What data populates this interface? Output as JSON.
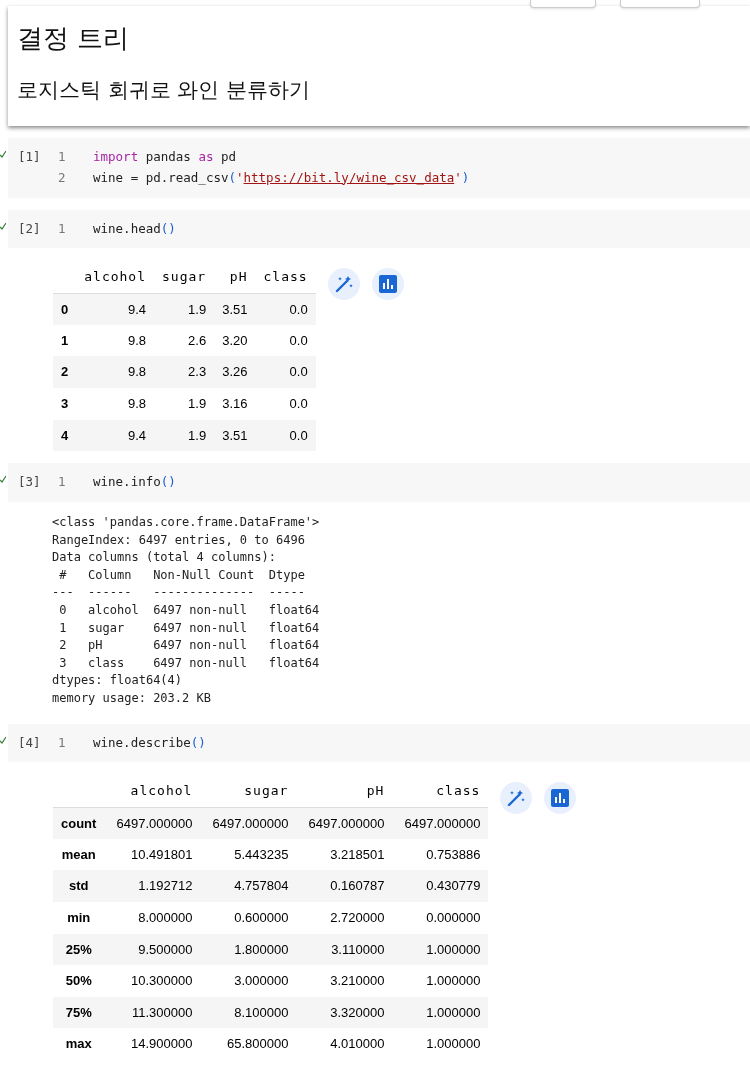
{
  "text_cell": {
    "title": "결정 트리",
    "subtitle": "로지스틱 회귀로 와인 분류하기"
  },
  "cells": [
    {
      "prompt": "[1]",
      "lines": [
        {
          "number": "1",
          "tokens": [
            {
              "kind": "keyword",
              "text": "import"
            },
            {
              "kind": "plain",
              "text": " pandas "
            },
            {
              "kind": "keyword",
              "text": "as"
            },
            {
              "kind": "plain",
              "text": " pd"
            }
          ]
        },
        {
          "number": "2",
          "tokens": [
            {
              "kind": "plain",
              "text": "wine = pd.read_csv"
            },
            {
              "kind": "paren",
              "text": "("
            },
            {
              "kind": "string",
              "text": "'"
            },
            {
              "kind": "link",
              "text": "https://bit.ly/wine_csv_data"
            },
            {
              "kind": "string",
              "text": "'"
            },
            {
              "kind": "paren",
              "text": ")"
            }
          ]
        }
      ]
    },
    {
      "prompt": "[2]",
      "lines": [
        {
          "number": "1",
          "tokens": [
            {
              "kind": "plain",
              "text": "wine.head"
            },
            {
              "kind": "paren",
              "text": "()"
            }
          ]
        }
      ],
      "output": {
        "kind": "table",
        "columns": [
          "alcohol",
          "sugar",
          "pH",
          "class"
        ],
        "rows": [
          {
            "index": "0",
            "values": [
              "9.4",
              "1.9",
              "3.51",
              "0.0"
            ]
          },
          {
            "index": "1",
            "values": [
              "9.8",
              "2.6",
              "3.20",
              "0.0"
            ]
          },
          {
            "index": "2",
            "values": [
              "9.8",
              "2.3",
              "3.26",
              "0.0"
            ]
          },
          {
            "index": "3",
            "values": [
              "9.8",
              "1.9",
              "3.16",
              "0.0"
            ]
          },
          {
            "index": "4",
            "values": [
              "9.4",
              "1.9",
              "3.51",
              "0.0"
            ]
          }
        ]
      }
    },
    {
      "prompt": "[3]",
      "lines": [
        {
          "number": "1",
          "tokens": [
            {
              "kind": "plain",
              "text": "wine.info"
            },
            {
              "kind": "paren",
              "text": "()"
            }
          ]
        }
      ],
      "output": {
        "kind": "text",
        "lines": [
          "<class 'pandas.core.frame.DataFrame'>",
          "RangeIndex: 6497 entries, 0 to 6496",
          "Data columns (total 4 columns):",
          " #   Column   Non-Null Count  Dtype  ",
          "---  ------   --------------  -----  ",
          " 0   alcohol  6497 non-null   float64",
          " 1   sugar    6497 non-null   float64",
          " 2   pH       6497 non-null   float64",
          " 3   class    6497 non-null   float64",
          "dtypes: float64(4)",
          "memory usage: 203.2 KB"
        ]
      }
    },
    {
      "prompt": "[4]",
      "lines": [
        {
          "number": "1",
          "tokens": [
            {
              "kind": "plain",
              "text": "wine.describe"
            },
            {
              "kind": "paren",
              "text": "()"
            }
          ]
        }
      ],
      "output": {
        "kind": "table",
        "columns": [
          "alcohol",
          "sugar",
          "pH",
          "class"
        ],
        "rows": [
          {
            "index": "count",
            "values": [
              "6497.000000",
              "6497.000000",
              "6497.000000",
              "6497.000000"
            ]
          },
          {
            "index": "mean",
            "values": [
              "10.491801",
              "5.443235",
              "3.218501",
              "0.753886"
            ]
          },
          {
            "index": "std",
            "values": [
              "1.192712",
              "4.757804",
              "0.160787",
              "0.430779"
            ]
          },
          {
            "index": "min",
            "values": [
              "8.000000",
              "0.600000",
              "2.720000",
              "0.000000"
            ]
          },
          {
            "index": "25%",
            "values": [
              "9.500000",
              "1.800000",
              "3.110000",
              "1.000000"
            ]
          },
          {
            "index": "50%",
            "values": [
              "10.300000",
              "3.000000",
              "3.210000",
              "1.000000"
            ]
          },
          {
            "index": "75%",
            "values": [
              "11.300000",
              "8.100000",
              "3.320000",
              "1.000000"
            ]
          },
          {
            "index": "max",
            "values": [
              "14.900000",
              "65.800000",
              "4.010000",
              "1.000000"
            ]
          }
        ]
      }
    }
  ]
}
